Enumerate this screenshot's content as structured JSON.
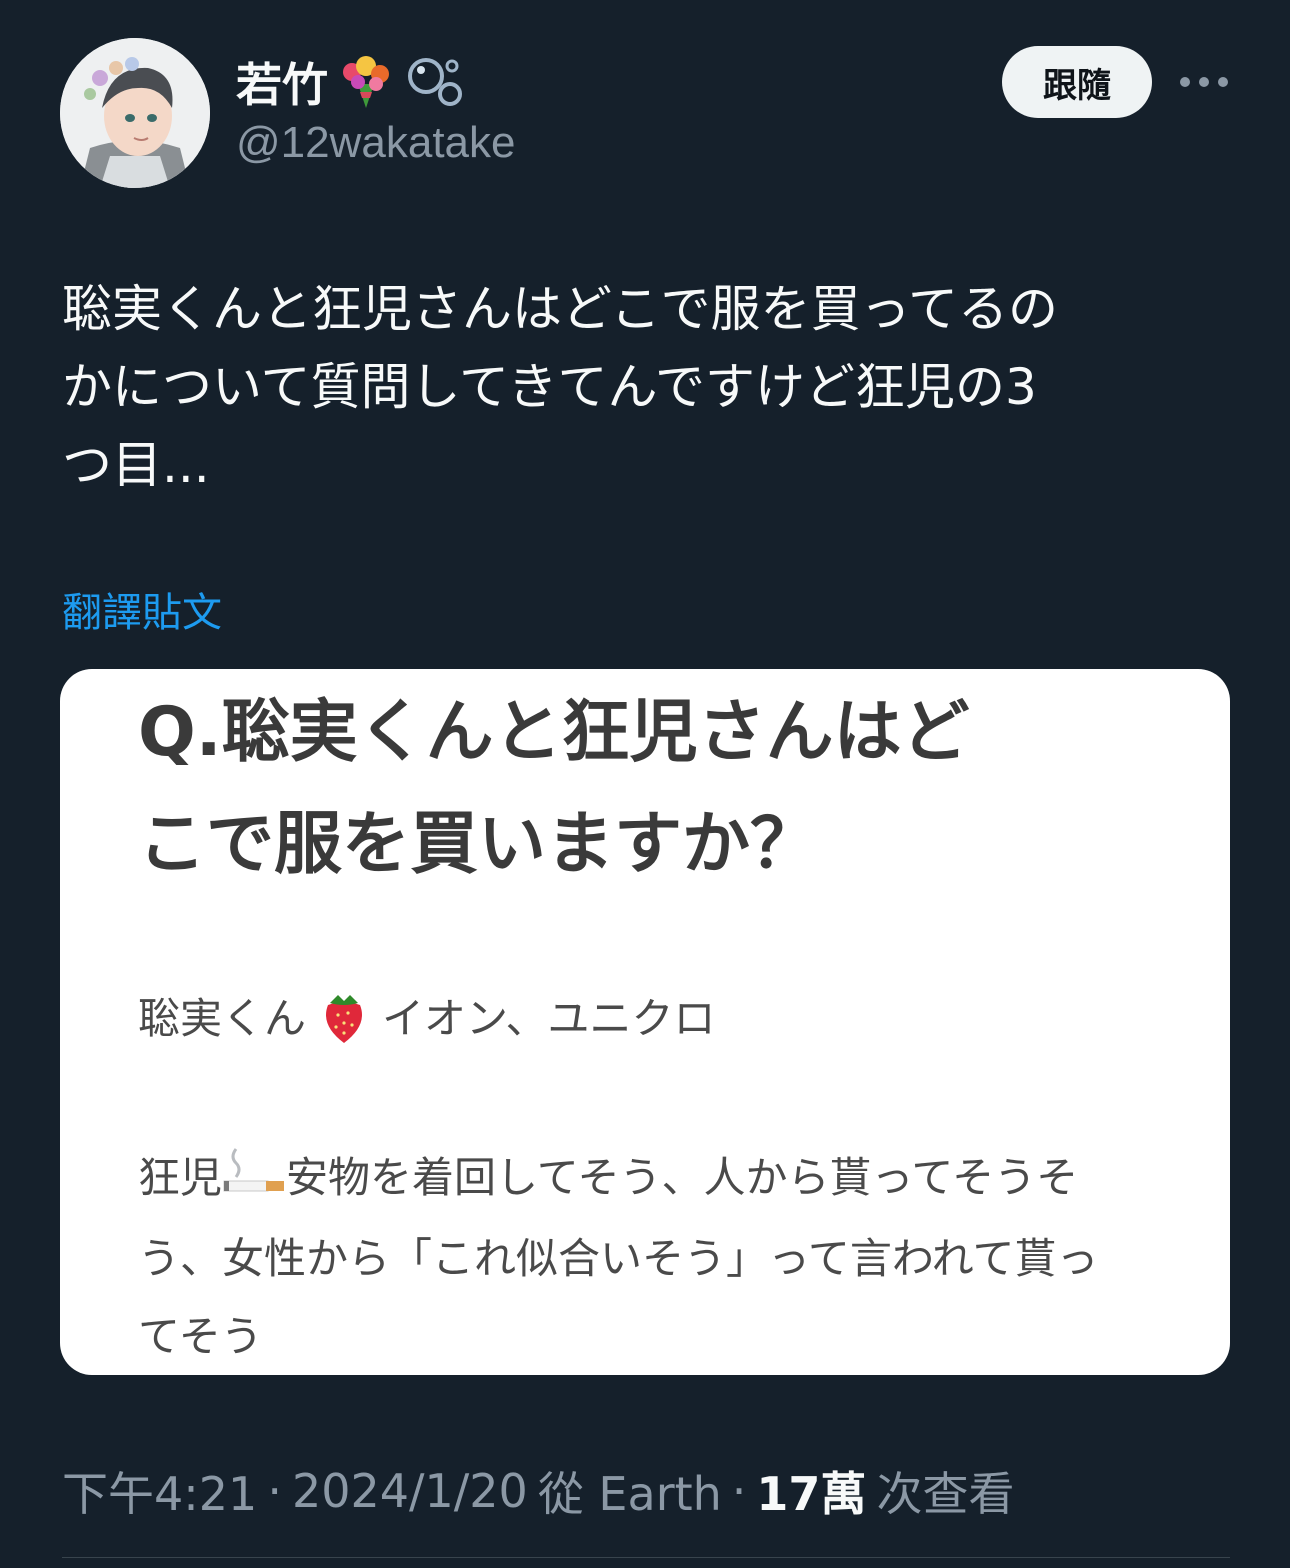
{
  "author": {
    "display_name": "若竹",
    "name_emojis": [
      "bouquet-icon",
      "bubbles-icon"
    ],
    "handle": "@12wakatake"
  },
  "actions": {
    "follow_label": "跟隨",
    "more_icon": "more-icon"
  },
  "tweet": {
    "text": "聡実くんと狂児さんはどこで服を買ってるの\nかについて質問してきてんですけど狂児の3\nつ目...",
    "translate_label": "翻譯貼文"
  },
  "media": {
    "question": "Q.聡実くんと狂児さんはど\nこで服を買いますか？",
    "satomi_name": "聡実くん",
    "satomi_emoji": "strawberry-icon",
    "satomi_answer": "イオン、ユニクロ",
    "kyoji_name": "狂児",
    "kyoji_emoji": "cigarette-icon",
    "kyoji_answer": "安物を着回してそう、人から貰ってそうそう、女性から「これ似合いそう」って言われて貰ってそう"
  },
  "meta": {
    "time": "下午4:21",
    "sep1": "·",
    "date": "2024/1/20",
    "source": "從 Earth",
    "sep2": "·",
    "views_count": "17萬",
    "views_label": "次查看"
  },
  "colors": {
    "background": "#15202b",
    "link": "#1d9bf0",
    "muted": "#8b98a5",
    "text": "#f7f9f9"
  }
}
